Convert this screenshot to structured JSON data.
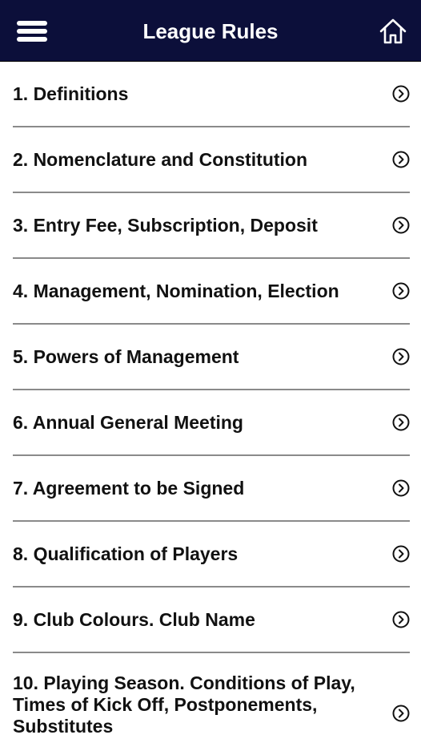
{
  "header": {
    "title": "League Rules",
    "menu_icon": "hamburger-menu-icon",
    "home_icon": "home-icon",
    "background": "#0c0f3a"
  },
  "rules": [
    {
      "label": "1. Definitions"
    },
    {
      "label": "2. Nomenclature and Constitution"
    },
    {
      "label": "3. Entry Fee, Subscription, Deposit"
    },
    {
      "label": "4. Management, Nomination, Election"
    },
    {
      "label": "5. Powers of Management"
    },
    {
      "label": "6. Annual General Meeting"
    },
    {
      "label": "7. Agreement to be Signed"
    },
    {
      "label": "8. Qualification of Players"
    },
    {
      "label": "9. Club Colours. Club Name"
    },
    {
      "label": "10. Playing Season. Conditions of Play, Times of Kick Off, Postponements, Substitutes"
    }
  ],
  "row_icon": "chevron-right-circle-icon"
}
